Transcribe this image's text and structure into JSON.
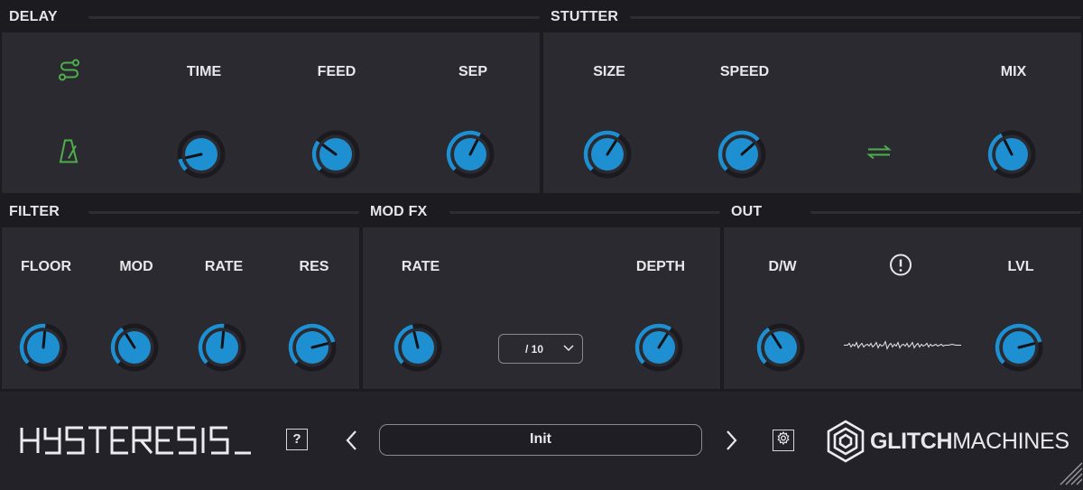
{
  "sections": {
    "delay": {
      "title": "DELAY",
      "time": "TIME",
      "feed": "FEED",
      "sep": "SEP"
    },
    "stutter": {
      "title": "STUTTER",
      "size": "SIZE",
      "speed": "SPEED",
      "mix": "MIX"
    },
    "filter": {
      "title": "FILTER",
      "floor": "FLOOR",
      "mod": "MOD",
      "rate": "RATE",
      "res": "RES"
    },
    "modfx": {
      "title": "MOD FX",
      "rate": "RATE",
      "depth": "DEPTH",
      "division": "/ 10"
    },
    "out": {
      "title": "OUT",
      "dw": "D/W",
      "lvl": "LVL"
    }
  },
  "knob_values": {
    "delay_time": 0.12,
    "delay_feed": 0.3,
    "delay_sep": 0.6,
    "stutter_size": 0.62,
    "stutter_speed": 0.68,
    "stutter_mix": 0.4,
    "filter_floor": 0.52,
    "filter_mod": 0.38,
    "filter_rate": 0.52,
    "filter_res": 0.78,
    "modfx_rate": 0.45,
    "modfx_depth": 0.62,
    "out_dw": 0.38,
    "out_lvl": 0.78
  },
  "footer": {
    "logo": "HYSTERESIS_",
    "help": "?",
    "preset": "Init",
    "brand_bold": "GLITCH",
    "brand_light": "MACHINES"
  },
  "icons": {
    "route": "route-icon",
    "metronome": "metronome-icon",
    "swap": "swap-arrows-icon",
    "warning": "alert-circle-icon",
    "settings": "gear-icon"
  },
  "colors": {
    "accent_blue": "#1e8fd0",
    "accent_green": "#4fae4c",
    "panel": "#2b2a31",
    "background": "#1c1b20"
  }
}
